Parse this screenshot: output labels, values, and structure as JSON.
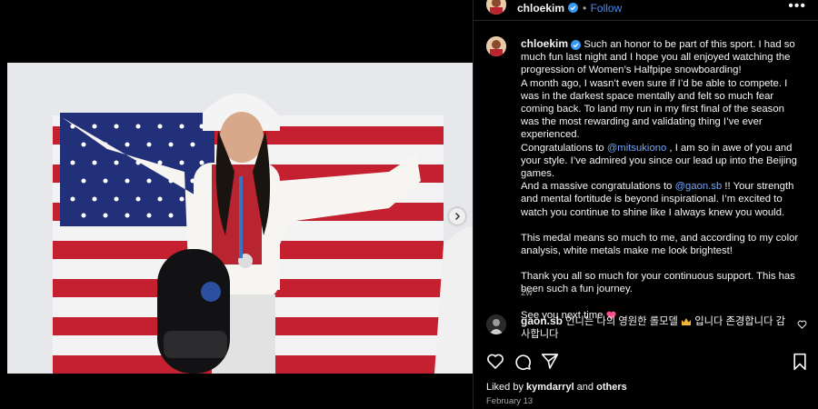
{
  "post": {
    "username": "chloekim",
    "follow_label": "Follow",
    "separator": "•",
    "more_label": "•••",
    "caption_lines": [
      "Such an honor to be part of this sport. I had so much fun last night and I hope you all enjoyed watching the progression of Women’s Halfpipe snowboarding!",
      "A month ago, I wasn’t even sure if I’d be able to compete. I was in the darkest space mentally and felt so much fear coming back. To land my run in my first final of the season was the most rewarding and validating thing I’ve ever experienced."
    ],
    "congrats_1_pre": "Congratulations to ",
    "mention_1": "@mitsukiono",
    "congrats_1_post": " , I am so in awe of you and your style. I’ve admired you since our lead up into the Beijing games.",
    "congrats_2_pre": "And a massive congratulations to ",
    "mention_2": "@gaon.sb",
    "congrats_2_post": " !! Your strength and mental fortitude is beyond inspirational. I’m excited to watch you continue to shine like I always knew you would.",
    "medal_text": "This medal means so much to me, and according to my color analysis, white metals make me look brightest!",
    "thanks_text": "Thank you all so much for your continuous support. This has been such a fun journey.",
    "see_you_text": "See you next time",
    "age": "2w",
    "likes_prefix": "Liked by ",
    "likes_user": "kymdarryl",
    "likes_and": " and ",
    "likes_others": "others",
    "date": "February 13"
  },
  "comment": {
    "username": "gaon.sb",
    "text_1": "언니는 나의 영원한 롤모델",
    "text_2": "입니다 존경합니다 감사합니다"
  },
  "icons": [
    "verified-icon",
    "more-icon",
    "heart-icon",
    "comment-icon",
    "share-icon",
    "bookmark-icon",
    "carousel-next-icon",
    "crown-emoji",
    "pink-heart-emoji"
  ],
  "colors": {
    "accent": "#4a8cf0",
    "mention": "#6ea5ff",
    "background": "#000000"
  }
}
